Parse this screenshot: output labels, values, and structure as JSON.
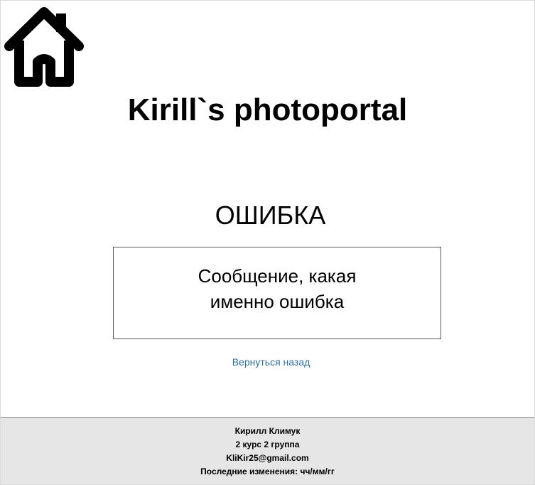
{
  "header": {
    "home_icon": "house-icon",
    "title": "Kirill`s photoportal"
  },
  "main": {
    "heading": "ОШИБКА",
    "message_line1": "Сообщение, какая",
    "message_line2": "именно ошибка",
    "back_link": "Вернуться назад"
  },
  "footer": {
    "name": "Кирилл Климук",
    "group": "2 курс 2 группа",
    "email": "KliKir25@gmail.com",
    "last_modified": "Последние изменения: чч/мм/гг"
  },
  "colors": {
    "link": "#2f6fa7",
    "footer_bg": "#e6e6e6",
    "text": "#000000"
  }
}
